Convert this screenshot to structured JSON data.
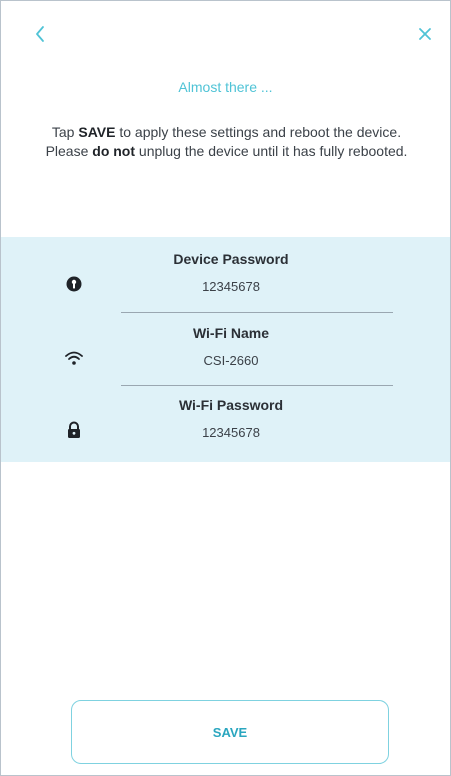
{
  "header": {
    "back_icon": "chevron-left-icon",
    "close_icon": "close-icon",
    "accent_color": "#4fc3d6"
  },
  "subtitle": "Almost there ...",
  "instructions": {
    "part1": "Tap ",
    "save_word": "SAVE",
    "part2": " to apply these settings and reboot the device. Please ",
    "do_not": "do not",
    "part3": " unplug the device until it has fully rebooted."
  },
  "settings": [
    {
      "icon": "device-password-icon",
      "title": "Device Password",
      "value": "12345678"
    },
    {
      "icon": "wifi-icon",
      "title": "Wi-Fi Name",
      "value": "CSI-2660"
    },
    {
      "icon": "lock-icon",
      "title": "Wi-Fi Password",
      "value": "12345678"
    }
  ],
  "panel_color": "#dff2f8",
  "save_button": {
    "label": "SAVE"
  }
}
